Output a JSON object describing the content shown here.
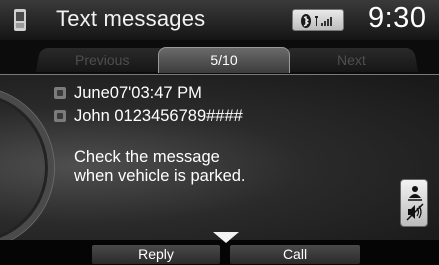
{
  "header": {
    "title": "Text messages",
    "clock": "9:30",
    "phone_icon": "phone-icon",
    "status_icons": [
      "bluetooth-icon",
      "signal-strength-icon"
    ]
  },
  "tabs": {
    "previous": "Previous",
    "page": "5/10",
    "next": "Next"
  },
  "message": {
    "date": "June07'03:47 PM",
    "sender": "John 0123456789####",
    "body_line1": "Check the message",
    "body_line2": "when vehicle is parked."
  },
  "side_button": {
    "icon": "voice-mute-icon"
  },
  "bottom": {
    "reply": "Reply",
    "call": "Call",
    "more_icon": "chevron-down-icon"
  },
  "colors": {
    "background": "#000000",
    "text": "#ffffff",
    "disabled_tab_text": "#4e4e4e"
  }
}
